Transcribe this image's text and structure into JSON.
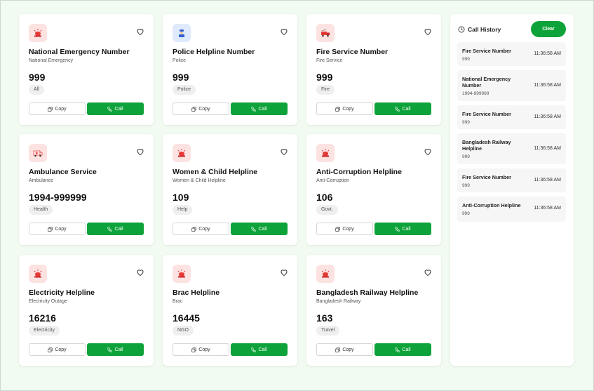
{
  "cards": [
    {
      "title": "National Emergency Number",
      "subtitle": "National Emergency",
      "number": "999",
      "tag": "All",
      "icon": "emergency-siren-icon",
      "copy_label": "Copy",
      "call_label": "Call"
    },
    {
      "title": "Police Helpline Number",
      "subtitle": "Police",
      "number": "999",
      "tag": "Police",
      "icon": "police-icon",
      "copy_label": "Copy",
      "call_label": "Call"
    },
    {
      "title": "Fire Service Number",
      "subtitle": "Fire Service",
      "number": "999",
      "tag": "Fire",
      "icon": "fire-truck-icon",
      "copy_label": "Copy",
      "call_label": "Call"
    },
    {
      "title": "Ambulance Service",
      "subtitle": "Ambulance",
      "number": "1994-999999",
      "tag": "Health",
      "icon": "ambulance-icon",
      "copy_label": "Copy",
      "call_label": "Call"
    },
    {
      "title": "Women & Child Helpline",
      "subtitle": "Women & Child Helpline",
      "number": "109",
      "tag": "Help",
      "icon": "emergency-siren-icon",
      "copy_label": "Copy",
      "call_label": "Call"
    },
    {
      "title": "Anti-Corruption Helpline",
      "subtitle": "Anti-Corruption",
      "number": "106",
      "tag": "Govt.",
      "icon": "emergency-siren-icon",
      "copy_label": "Copy",
      "call_label": "Call"
    },
    {
      "title": "Electricity Helpline",
      "subtitle": "Electricity Outage",
      "number": "16216",
      "tag": "Electricity",
      "icon": "emergency-siren-icon",
      "copy_label": "Copy",
      "call_label": "Call"
    },
    {
      "title": "Brac Helpline",
      "subtitle": "Brac",
      "number": "16445",
      "tag": "NGO",
      "icon": "emergency-siren-icon",
      "copy_label": "Copy",
      "call_label": "Call"
    },
    {
      "title": "Bangladesh Railway Helpline",
      "subtitle": "Bangladesh Railway",
      "number": "163",
      "tag": "Travel",
      "icon": "emergency-siren-icon",
      "copy_label": "Copy",
      "call_label": "Call"
    }
  ],
  "history": {
    "title": "Call History",
    "clear_label": "Clear",
    "items": [
      {
        "name": "Fire Service Number",
        "number": "999",
        "time": "11:36:58 AM"
      },
      {
        "name": "National Emergency Number",
        "number": "1994-999999",
        "time": "11:36:58 AM"
      },
      {
        "name": "Fire Service Number",
        "number": "999",
        "time": "11:36:58 AM"
      },
      {
        "name": "Bangladesh Railway Helpline",
        "number": "999",
        "time": "11:36:58 AM"
      },
      {
        "name": "Fire Service Number",
        "number": "999",
        "time": "11:36:58 AM"
      },
      {
        "name": "Anti-Corruption Helpline",
        "number": "999",
        "time": "11:36:58 AM"
      }
    ]
  },
  "colors": {
    "accent": "#0ea33a",
    "background": "#f1fbf1",
    "icon_red_bg": "#fde2e2",
    "icon_blue_bg": "#dfeafc"
  }
}
